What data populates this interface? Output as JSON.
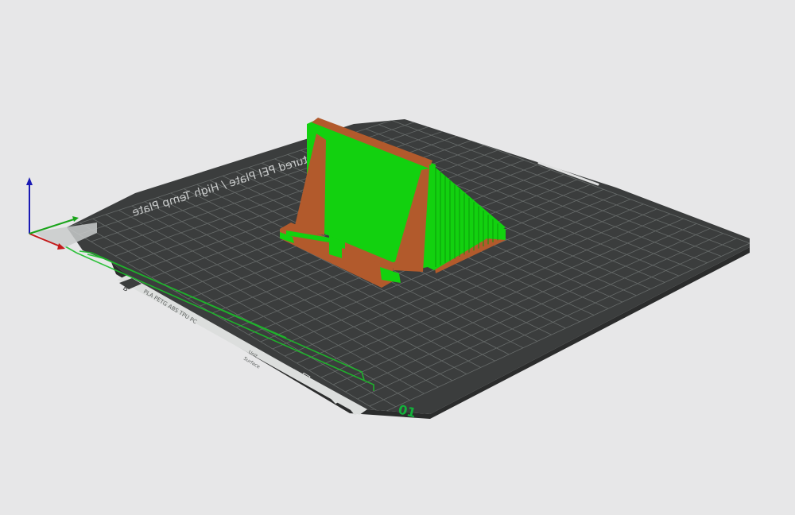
{
  "viewport": {
    "background": "#e7e7e8",
    "plate_color": "#3b3d3d",
    "grid_color": "#6c706f",
    "model_colors": {
      "paint": "#12d10f",
      "base": "#b25a2c"
    }
  },
  "plate": {
    "label": "Bambu Textured PEI Plate / High Temp Plate",
    "side_code": "B",
    "materials": "PLA PETG ABS TPU PC",
    "note_line1": "Unit",
    "note_line2": "Surface",
    "number": "01",
    "number_color": "#13b13b"
  },
  "axes": {
    "x_color": "#c41a1a",
    "y_color": "#1aa41a",
    "z_color": "#1a1ab4"
  },
  "icons": [
    "axis-gizmo-icon"
  ]
}
